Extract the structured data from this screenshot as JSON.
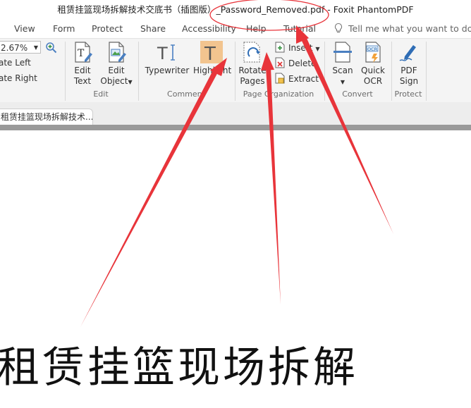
{
  "window": {
    "title_before": "租赁挂篮现场拆解技术交底书（插图版）",
    "title_file": "_Password_Removed.pdf",
    "title_app": " - Foxit PhantomPDF"
  },
  "menu": {
    "items": [
      "View",
      "Form",
      "Protect",
      "Share",
      "Accessibility",
      "Help",
      "Tutorial"
    ],
    "tell_me_placeholder": "Tell me what you want to do..."
  },
  "ribbon": {
    "zoom_value": "2.67%",
    "rotate_left": "ate Left",
    "rotate_right": "ate Right",
    "edit_text": [
      "Edit",
      "Text"
    ],
    "edit_object": [
      "Edit",
      "Object"
    ],
    "group_edit": "Edit",
    "typewriter": "Typewriter",
    "highlight": "Highlight",
    "group_comment": "Comment",
    "rotate_pages": [
      "Rotate",
      "Pages"
    ],
    "insert": "Insert",
    "delete": "Delete",
    "extract": "Extract",
    "group_page_org": "Page Organization",
    "scan": "Scan",
    "quick_ocr": [
      "Quick",
      "OCR"
    ],
    "group_convert": "Convert",
    "pdf_sign": [
      "PDF",
      "Sign"
    ],
    "group_protect": "Protect"
  },
  "tabs": {
    "document_tab": "租赁挂篮现场拆解技术..."
  },
  "document": {
    "heading": "租赁挂篮现场拆解"
  },
  "colors": {
    "annotation_red": "#e8343a",
    "highlight_orange": "#f2c48f"
  }
}
